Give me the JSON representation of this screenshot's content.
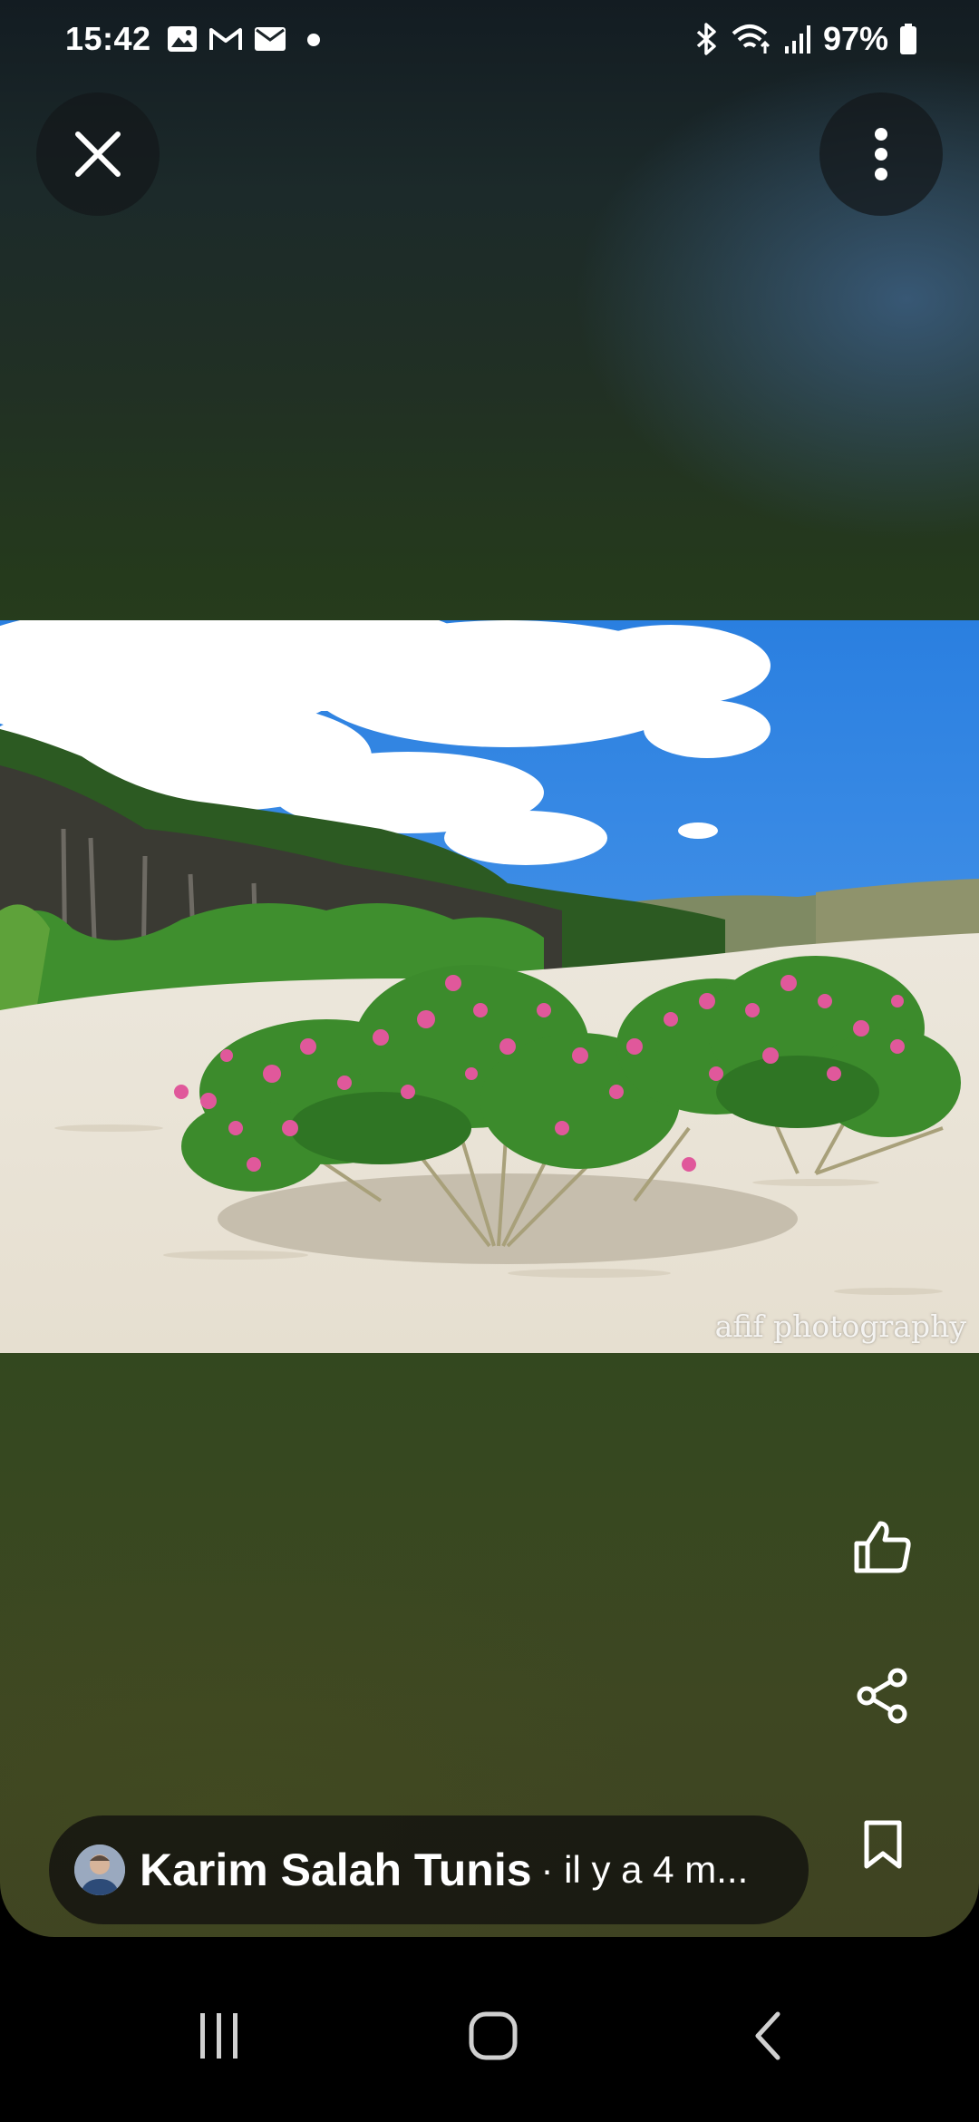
{
  "status_bar": {
    "time": "15:42",
    "left_icons": [
      "image-icon",
      "gmail-icon",
      "email-icon",
      "dot-icon"
    ],
    "right_icons": [
      "bluetooth-icon",
      "wifi-icon",
      "signal-icon"
    ],
    "battery_percent": "97%"
  },
  "top_controls": {
    "close_icon": "close-icon",
    "more_icon": "more-vertical-icon"
  },
  "photo": {
    "watermark": "afif photography"
  },
  "actions": {
    "like_icon": "thumbs-up-icon",
    "share_icon": "share-icon",
    "save_icon": "bookmark-icon"
  },
  "author": {
    "name": "Karim Salah Tunis",
    "meta": "· il y a 4 m..."
  },
  "nav": {
    "recents_icon": "recents-icon",
    "home_icon": "home-icon",
    "back_icon": "back-icon"
  },
  "colors": {
    "icon": "#ffffff",
    "pill_background": "#16160f",
    "sky": "#2f86e6",
    "sand": "#e9e3d6",
    "blossom": "#e0589b"
  }
}
